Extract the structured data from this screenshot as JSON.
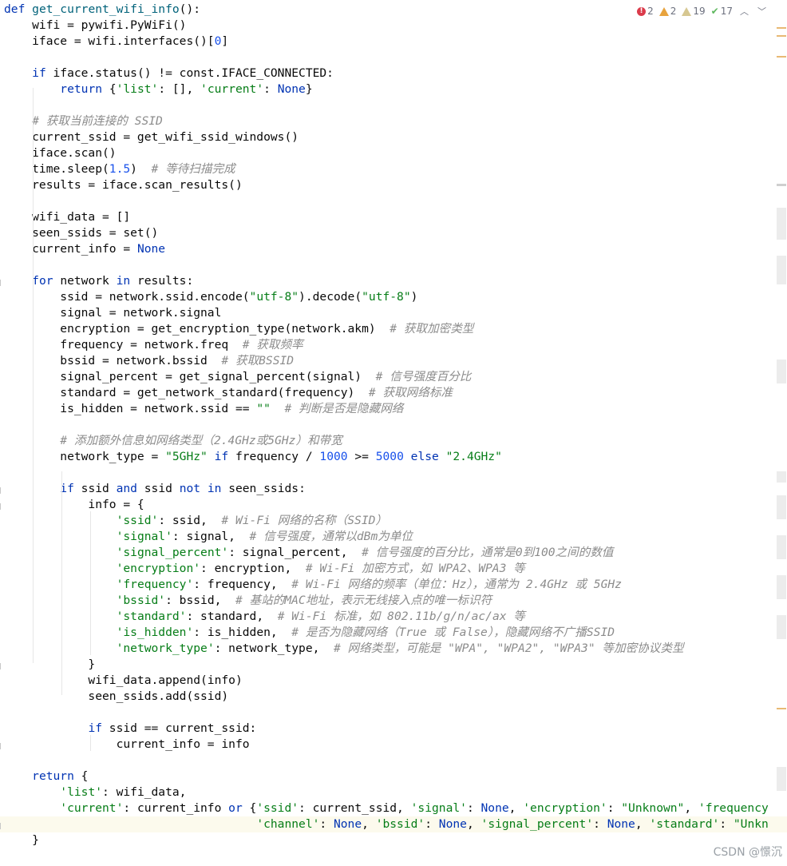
{
  "inspections": {
    "errors": "2",
    "warnings": "2",
    "weak_warnings": "19",
    "typos": "17"
  },
  "watermark": "CSDN @憬沉",
  "code_lines": [
    [
      [
        "kw",
        "def "
      ],
      [
        "fn",
        "get_current_wifi_info"
      ],
      [
        "",
        "():"
      ]
    ],
    [
      [
        "",
        "    wifi = pywifi.PyWiFi()"
      ]
    ],
    [
      [
        "",
        "    iface = wifi.interfaces()["
      ],
      [
        "num",
        "0"
      ],
      [
        "",
        "]"
      ]
    ],
    [],
    [
      [
        "",
        "    "
      ],
      [
        "kw",
        "if "
      ],
      [
        "",
        "iface.status() != const.IFACE_CONNECTED:"
      ]
    ],
    [
      [
        "",
        "        "
      ],
      [
        "kw",
        "return "
      ],
      [
        "",
        "{"
      ],
      [
        "str",
        "'list'"
      ],
      [
        "",
        ": [], "
      ],
      [
        "str",
        "'current'"
      ],
      [
        "",
        ": "
      ],
      [
        "kw",
        "None"
      ],
      [
        "",
        "}"
      ]
    ],
    [],
    [
      [
        "cmt",
        "    # 获取当前连接的 SSID"
      ]
    ],
    [
      [
        "",
        "    current_ssid = get_wifi_ssid_windows()"
      ]
    ],
    [
      [
        "",
        "    iface.scan()"
      ]
    ],
    [
      [
        "",
        "    time.sleep("
      ],
      [
        "num",
        "1.5"
      ],
      [
        "",
        ")  "
      ],
      [
        "cmt",
        "# 等待扫描完成"
      ]
    ],
    [
      [
        "",
        "    results = iface.scan_results()"
      ]
    ],
    [],
    [
      [
        "",
        "    wifi_data = []"
      ]
    ],
    [
      [
        "",
        "    seen_ssids = set()"
      ]
    ],
    [
      [
        "",
        "    current_info = "
      ],
      [
        "kw",
        "None"
      ]
    ],
    [],
    [
      [
        "",
        "    "
      ],
      [
        "kw",
        "for "
      ],
      [
        "",
        "network "
      ],
      [
        "kw",
        "in "
      ],
      [
        "",
        "results:"
      ]
    ],
    [
      [
        "",
        "        ssid = network.ssid.encode("
      ],
      [
        "str",
        "\"utf-8\""
      ],
      [
        "",
        ").decode("
      ],
      [
        "str",
        "\"utf-8\""
      ],
      [
        "",
        ")"
      ]
    ],
    [
      [
        "",
        "        signal = network.signal"
      ]
    ],
    [
      [
        "",
        "        encryption = get_encryption_type(network.akm)  "
      ],
      [
        "cmt",
        "# 获取加密类型"
      ]
    ],
    [
      [
        "",
        "        frequency = network.freq  "
      ],
      [
        "cmt",
        "# 获取频率"
      ]
    ],
    [
      [
        "",
        "        bssid = network.bssid  "
      ],
      [
        "cmt",
        "# 获取BSSID"
      ]
    ],
    [
      [
        "",
        "        signal_percent = get_signal_percent(signal)  "
      ],
      [
        "cmt",
        "# 信号强度百分比"
      ]
    ],
    [
      [
        "",
        "        standard = get_network_standard(frequency)  "
      ],
      [
        "cmt",
        "# 获取网络标准"
      ]
    ],
    [
      [
        "",
        "        is_hidden = network.ssid == "
      ],
      [
        "str",
        "\"\""
      ],
      [
        "",
        "  "
      ],
      [
        "cmt",
        "# 判断是否是隐藏网络"
      ]
    ],
    [],
    [
      [
        "cmt",
        "        # 添加额外信息如网络类型（2.4GHz或5GHz）和带宽"
      ]
    ],
    [
      [
        "",
        "        network_type = "
      ],
      [
        "str",
        "\"5GHz\""
      ],
      [
        "kw",
        " if "
      ],
      [
        "",
        "frequency / "
      ],
      [
        "num",
        "1000"
      ],
      [
        "",
        " >= "
      ],
      [
        "num",
        "5000"
      ],
      [
        "kw",
        " else "
      ],
      [
        "str",
        "\"2.4GHz\""
      ]
    ],
    [],
    [
      [
        "",
        "        "
      ],
      [
        "kw",
        "if "
      ],
      [
        "",
        "ssid "
      ],
      [
        "kw",
        "and "
      ],
      [
        "",
        "ssid "
      ],
      [
        "kw",
        "not in "
      ],
      [
        "",
        "seen_ssids:"
      ]
    ],
    [
      [
        "",
        "            info = {"
      ]
    ],
    [
      [
        "",
        "                "
      ],
      [
        "str",
        "'ssid'"
      ],
      [
        "",
        ": ssid,  "
      ],
      [
        "cmt",
        "# Wi-Fi 网络的名称（SSID）"
      ]
    ],
    [
      [
        "",
        "                "
      ],
      [
        "str",
        "'signal'"
      ],
      [
        "",
        ": signal,  "
      ],
      [
        "cmt",
        "# 信号强度，通常以dBm为单位"
      ]
    ],
    [
      [
        "",
        "                "
      ],
      [
        "str",
        "'signal_percent'"
      ],
      [
        "",
        ": signal_percent,  "
      ],
      [
        "cmt",
        "# 信号强度的百分比，通常是0到100之间的数值"
      ]
    ],
    [
      [
        "",
        "                "
      ],
      [
        "str",
        "'encryption'"
      ],
      [
        "",
        ": encryption,  "
      ],
      [
        "cmt",
        "# Wi-Fi 加密方式，如 WPA2、WPA3 等"
      ]
    ],
    [
      [
        "",
        "                "
      ],
      [
        "str",
        "'frequency'"
      ],
      [
        "",
        ": frequency,  "
      ],
      [
        "cmt",
        "# Wi-Fi 网络的频率（单位：Hz），通常为 2.4GHz 或 5GHz"
      ]
    ],
    [
      [
        "",
        "                "
      ],
      [
        "str",
        "'bssid'"
      ],
      [
        "",
        ": bssid,  "
      ],
      [
        "cmt",
        "# 基站的MAC地址，表示无线接入点的唯一标识符"
      ]
    ],
    [
      [
        "",
        "                "
      ],
      [
        "str",
        "'standard'"
      ],
      [
        "",
        ": standard,  "
      ],
      [
        "cmt",
        "# Wi-Fi 标准，如 802.11b/g/n/ac/ax 等"
      ]
    ],
    [
      [
        "",
        "                "
      ],
      [
        "str",
        "'is_hidden'"
      ],
      [
        "",
        ": is_hidden,  "
      ],
      [
        "cmt",
        "# 是否为隐藏网络（True 或 False），隐藏网络不广播SSID"
      ]
    ],
    [
      [
        "",
        "                "
      ],
      [
        "str",
        "'network_type'"
      ],
      [
        "",
        ": network_type,  "
      ],
      [
        "cmt",
        "# 网络类型，可能是 \"WPA\", \"WPA2\", \"WPA3\" 等加密协议类型"
      ]
    ],
    [
      [
        "",
        "            }"
      ]
    ],
    [
      [
        "",
        "            wifi_data.append(info)"
      ]
    ],
    [
      [
        "",
        "            seen_ssids.add(ssid)"
      ]
    ],
    [],
    [
      [
        "",
        "            "
      ],
      [
        "kw",
        "if "
      ],
      [
        "",
        "ssid == current_ssid:"
      ]
    ],
    [
      [
        "",
        "                current_info = info"
      ]
    ],
    [],
    [
      [
        "",
        "    "
      ],
      [
        "kw",
        "return "
      ],
      [
        "",
        "{"
      ]
    ],
    [
      [
        "",
        "        "
      ],
      [
        "str",
        "'list'"
      ],
      [
        "",
        ": wifi_data,"
      ]
    ],
    [
      [
        "",
        "        "
      ],
      [
        "str",
        "'current'"
      ],
      [
        "",
        ": current_info "
      ],
      [
        "kw",
        "or "
      ],
      [
        "",
        "{"
      ],
      [
        "str",
        "'ssid'"
      ],
      [
        "",
        ": current_ssid, "
      ],
      [
        "str",
        "'signal'"
      ],
      [
        "",
        ": "
      ],
      [
        "kw",
        "None"
      ],
      [
        "",
        ", "
      ],
      [
        "str",
        "'encryption'"
      ],
      [
        "",
        ": "
      ],
      [
        "str",
        "\"Unknown\""
      ],
      [
        "",
        ", "
      ],
      [
        "str",
        "'frequency"
      ]
    ],
    [
      [
        "",
        "                                    "
      ],
      [
        "str",
        "'channel'"
      ],
      [
        "",
        ": "
      ],
      [
        "kw",
        "None"
      ],
      [
        "",
        ", "
      ],
      [
        "str",
        "'bssid'"
      ],
      [
        "",
        ": "
      ],
      [
        "kw",
        "None"
      ],
      [
        "",
        ", "
      ],
      [
        "str",
        "'signal_percent'"
      ],
      [
        "",
        ": "
      ],
      [
        "kw",
        "None"
      ],
      [
        "",
        ", "
      ],
      [
        "str",
        "'standard'"
      ],
      [
        "",
        ": "
      ],
      [
        "str",
        "\"Unkn"
      ]
    ],
    [
      [
        "",
        "    }"
      ]
    ]
  ]
}
